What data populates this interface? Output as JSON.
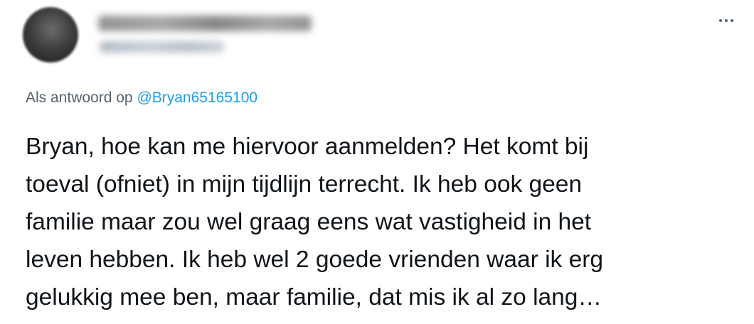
{
  "tweet": {
    "avatar_icon": "avatar-blurred",
    "more_icon": "more-horizontal-icon",
    "reply_to": {
      "prefix": "Als antwoord op",
      "mention": "@Bryan65165100"
    },
    "text_lines": [
      "Bryan, hoe kan me hiervoor aanmelden? Het komt bij",
      "toeval (ofniet) in mijn tijdlijn terrecht. Ik heb ook geen",
      "familie maar zou wel graag eens wat vastigheid in het",
      "leven hebben. Ik heb wel 2 goede vrienden waar ik erg",
      "gelukkig mee ben, maar familie, dat mis ik al zo lang…"
    ]
  },
  "colors": {
    "text": "#0f1419",
    "secondary": "#536471",
    "link": "#1d9bf0",
    "background": "#ffffff"
  }
}
